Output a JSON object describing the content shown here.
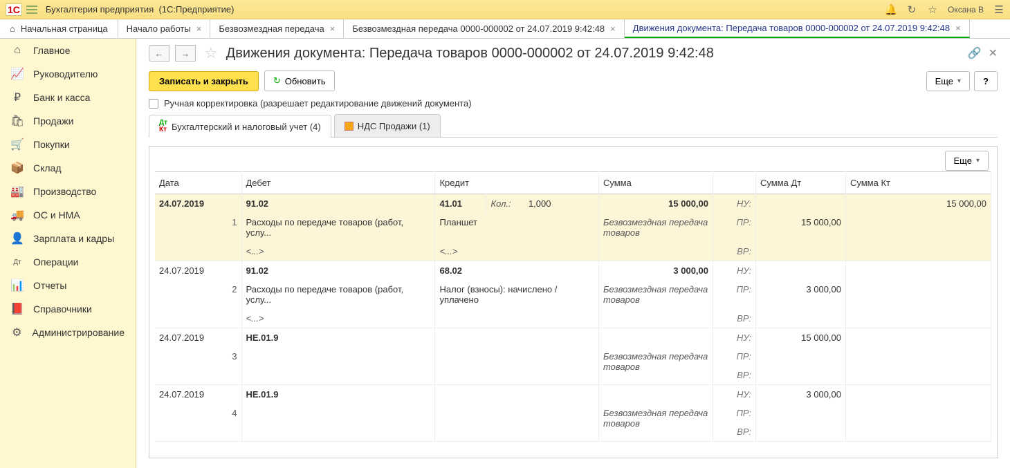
{
  "titlebar": {
    "app_name": "Бухгалтерия предприятия",
    "app_suffix": "(1С:Предприятие)",
    "user": "Оксана В"
  },
  "top_tabs": {
    "home": "Начальная страница",
    "t1": "Начало работы",
    "t2": "Безвозмездная передача",
    "t3": "Безвозмездная передача 0000-000002 от 24.07.2019 9:42:48",
    "t4": "Движения документа: Передача товаров 0000-000002 от 24.07.2019 9:42:48"
  },
  "sidebar": {
    "items": [
      {
        "label": "Главное",
        "icon": "⌂"
      },
      {
        "label": "Руководителю",
        "icon": "📈"
      },
      {
        "label": "Банк и касса",
        "icon": "₽"
      },
      {
        "label": "Продажи",
        "icon": "🛍"
      },
      {
        "label": "Покупки",
        "icon": "🛒"
      },
      {
        "label": "Склад",
        "icon": "📦"
      },
      {
        "label": "Производство",
        "icon": "🏭"
      },
      {
        "label": "ОС и НМА",
        "icon": "🚚"
      },
      {
        "label": "Зарплата и кадры",
        "icon": "👤"
      },
      {
        "label": "Операции",
        "icon": "Дт"
      },
      {
        "label": "Отчеты",
        "icon": "📊"
      },
      {
        "label": "Справочники",
        "icon": "📕"
      },
      {
        "label": "Администрирование",
        "icon": "⚙"
      }
    ]
  },
  "page": {
    "title": "Движения документа: Передача товаров 0000-000002 от 24.07.2019 9:42:48",
    "save_btn": "Записать и закрыть",
    "refresh_btn": "Обновить",
    "more_btn": "Еще",
    "help_btn": "?",
    "checkbox_label": "Ручная корректировка (разрешает редактирование движений документа)",
    "tab1": "Бухгалтерский и налоговый учет (4)",
    "tab2": "НДС Продажи (1)"
  },
  "table": {
    "headers": {
      "date": "Дата",
      "debet": "Дебет",
      "credit": "Кредит",
      "sum": "Сумма",
      "sum_dt": "Сумма Дт",
      "sum_kt": "Сумма Кт"
    },
    "kol_label": "Кол.:",
    "nu": "НУ:",
    "pr": "ПР:",
    "vr": "ВР:",
    "dots": "<...>",
    "rows": [
      {
        "n": "1",
        "date": "24.07.2019",
        "d_acc": "91.02",
        "d_desc": "Расходы по передаче товаров (работ, услу...",
        "c_acc": "41.01",
        "kol": "1,000",
        "c_desc": "Планшет",
        "sum": "15 000,00",
        "sum_desc": "Безвозмездная передача товаров",
        "nu_kt": "15 000,00",
        "pr_dt": "15 000,00"
      },
      {
        "n": "2",
        "date": "24.07.2019",
        "d_acc": "91.02",
        "d_desc": "Расходы по передаче товаров (работ, услу...",
        "c_acc": "68.02",
        "c_desc": "Налог (взносы): начислено / уплачено",
        "sum": "3 000,00",
        "sum_desc": "Безвозмездная передача товаров",
        "pr_dt": "3 000,00"
      },
      {
        "n": "3",
        "date": "24.07.2019",
        "d_acc": "НЕ.01.9",
        "sum_desc": "Безвозмездная передача товаров",
        "nu_dt": "15 000,00"
      },
      {
        "n": "4",
        "date": "24.07.2019",
        "d_acc": "НЕ.01.9",
        "sum_desc": "Безвозмездная передача товаров",
        "nu_dt": "3 000,00"
      }
    ]
  }
}
